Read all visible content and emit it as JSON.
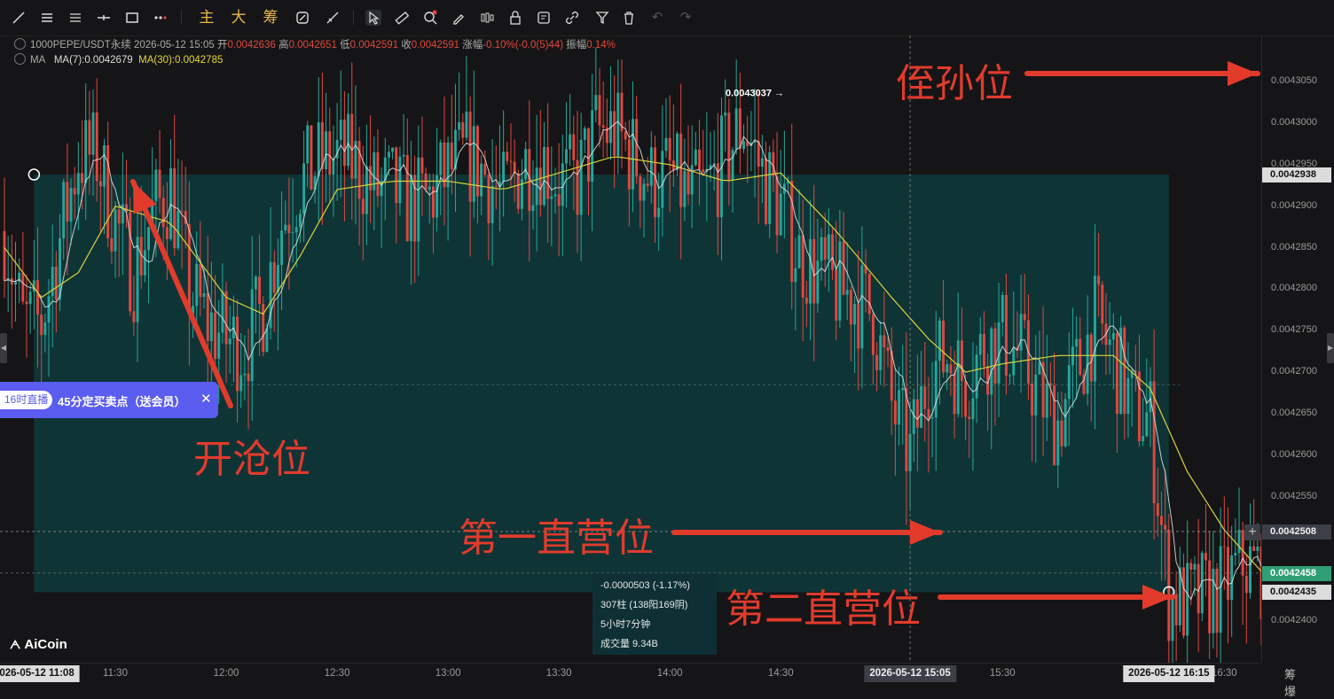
{
  "toolbar": {
    "btn_main": "主",
    "btn_big": "大",
    "btn_chips": "筹"
  },
  "info": {
    "symbol": "1000PEPE/USDT永续",
    "datetime": "2026-05-12 15:05",
    "open_label": "开",
    "open": "0.0042636",
    "high_label": "高",
    "high": "0.0042651",
    "low_label": "低",
    "low": "0.0042591",
    "close_label": "收",
    "close": "0.0042591",
    "change_label": "涨幅",
    "change": "-0.10%(-0.0(5)44)",
    "amp_label": "振幅",
    "amp": "0.14%",
    "ma_label": "MA",
    "ma7": "MA(7):0.0042679",
    "ma30": "MA(30):0.0042785"
  },
  "chart_data": {
    "type": "candlestick",
    "title": "",
    "interval": "1m",
    "x_start": "11:00",
    "x_end": "16:40",
    "ylim": [
      0.004235,
      0.004308
    ],
    "y_ticks": [
      "0.0043050",
      "0.0043000",
      "0.0042950",
      "0.0042900",
      "0.0042850",
      "0.0042800",
      "0.0042750",
      "0.0042700",
      "0.0042650",
      "0.0042600",
      "0.0042550",
      "0.0042500",
      "0.0042450",
      "0.0042400"
    ],
    "x_ticks": [
      "11:30",
      "12:00",
      "12:30",
      "13:00",
      "13:30",
      "14:00",
      "14:30",
      "15:30",
      "16:30"
    ],
    "max_label": "0.0043037",
    "price_path": [
      [
        "11:00",
        0.004287
      ],
      [
        "11:05",
        0.004276
      ],
      [
        "11:10",
        0.004276
      ],
      [
        "11:15",
        0.004286
      ],
      [
        "11:20",
        0.004296
      ],
      [
        "11:25",
        0.004296
      ],
      [
        "11:30",
        0.004288
      ],
      [
        "11:35",
        0.004282
      ],
      [
        "11:40",
        0.004289
      ],
      [
        "11:45",
        0.004292
      ],
      [
        "11:50",
        0.00428
      ],
      [
        "11:55",
        0.004276
      ],
      [
        "12:00",
        0.004274
      ],
      [
        "12:05",
        0.004273
      ],
      [
        "12:10",
        0.004278
      ],
      [
        "12:15",
        0.004288
      ],
      [
        "12:20",
        0.004293
      ],
      [
        "12:25",
        0.004295
      ],
      [
        "12:30",
        0.004296
      ],
      [
        "12:35",
        0.004295
      ],
      [
        "12:40",
        0.004292
      ],
      [
        "12:45",
        0.004292
      ],
      [
        "12:50",
        0.00429
      ],
      [
        "12:55",
        0.004291
      ],
      [
        "13:00",
        0.004294
      ],
      [
        "13:05",
        0.004296
      ],
      [
        "13:10",
        0.004294
      ],
      [
        "13:15",
        0.004291
      ],
      [
        "13:20",
        0.004295
      ],
      [
        "13:25",
        0.004296
      ],
      [
        "13:30",
        0.004293
      ],
      [
        "13:35",
        0.004293
      ],
      [
        "13:40",
        0.004299
      ],
      [
        "13:45",
        0.004299
      ],
      [
        "13:50",
        0.004296
      ],
      [
        "13:55",
        0.004293
      ],
      [
        "14:00",
        0.004294
      ],
      [
        "14:05",
        0.004291
      ],
      [
        "14:10",
        0.004292
      ],
      [
        "14:15",
        0.004296
      ],
      [
        "14:20",
        0.0043
      ],
      [
        "14:25",
        0.004294
      ],
      [
        "14:30",
        0.00429
      ],
      [
        "14:35",
        0.004284
      ],
      [
        "14:40",
        0.004282
      ],
      [
        "14:45",
        0.00428
      ],
      [
        "14:50",
        0.004279
      ],
      [
        "14:55",
        0.004277
      ],
      [
        "15:00",
        0.004266
      ],
      [
        "15:05",
        0.00426
      ],
      [
        "15:10",
        0.00427
      ],
      [
        "15:15",
        0.004272
      ],
      [
        "15:20",
        0.004269
      ],
      [
        "15:25",
        0.004273
      ],
      [
        "15:30",
        0.004274
      ],
      [
        "15:35",
        0.004272
      ],
      [
        "15:40",
        0.004267
      ],
      [
        "15:45",
        0.004264
      ],
      [
        "15:50",
        0.00427
      ],
      [
        "15:55",
        0.004276
      ],
      [
        "16:00",
        0.004272
      ],
      [
        "16:05",
        0.004266
      ],
      [
        "16:10",
        0.004264
      ],
      [
        "16:15",
        0.004243
      ],
      [
        "16:20",
        0.004242
      ],
      [
        "16:25",
        0.004243
      ],
      [
        "16:30",
        0.004244
      ],
      [
        "16:35",
        0.004247
      ],
      [
        "16:40",
        0.004246
      ]
    ],
    "ma30_path": [
      [
        "11:00",
        0.004285
      ],
      [
        "11:10",
        0.004279
      ],
      [
        "11:20",
        0.004282
      ],
      [
        "11:30",
        0.00429
      ],
      [
        "11:45",
        0.004288
      ],
      [
        "12:00",
        0.004279
      ],
      [
        "12:10",
        0.004277
      ],
      [
        "12:20",
        0.004284
      ],
      [
        "12:30",
        0.004292
      ],
      [
        "12:45",
        0.004293
      ],
      [
        "13:00",
        0.004293
      ],
      [
        "13:15",
        0.004292
      ],
      [
        "13:30",
        0.004294
      ],
      [
        "13:45",
        0.004296
      ],
      [
        "14:00",
        0.004295
      ],
      [
        "14:15",
        0.004293
      ],
      [
        "14:30",
        0.004294
      ],
      [
        "14:45",
        0.004287
      ],
      [
        "15:00",
        0.004279
      ],
      [
        "15:10",
        0.004274
      ],
      [
        "15:20",
        0.00427
      ],
      [
        "15:30",
        0.004271
      ],
      [
        "15:45",
        0.004272
      ],
      [
        "16:00",
        0.004272
      ],
      [
        "16:10",
        0.004268
      ],
      [
        "16:20",
        0.004258
      ],
      [
        "16:30",
        0.004251
      ],
      [
        "16:40",
        0.004246
      ]
    ],
    "position_box": {
      "from": "11:08",
      "to": "16:15",
      "top": 0.0042938,
      "bottom": 0.0042435
    },
    "crosshair": {
      "time": "2026-05-12 15:05",
      "price": "0.0042508"
    },
    "price_tags": {
      "entry": "0.0042938",
      "crosshair": "0.0042508",
      "last": "0.0042458",
      "box_bottom": "0.0042435"
    },
    "range_stats": {
      "change": "-0.0000503 (-1.17%)",
      "bars": "307柱 (138阳169阴)",
      "duration": "5小时7分钟",
      "volume": "成交量 9.34B"
    },
    "x_tags": {
      "left": "2026-05-12 11:08",
      "mid": "2026-05-12 15:05",
      "right": "2026-05-12 16:15"
    },
    "colors": {
      "up": "#26a69a",
      "down": "#e0483f",
      "ma7": "#e6e6e6",
      "ma30": "#d9d23a",
      "box": "#0e3a3c",
      "annotation": "#e23b2c"
    }
  },
  "annotations": {
    "stop": "侄孙位",
    "entry": "开沧位",
    "tp1": "第一直营位",
    "tp2": "第二直营位"
  },
  "promo": {
    "tag": "16时直播",
    "text": "45分定买卖点（送会员）",
    "close": "✕"
  },
  "logo": "AiCoin",
  "corner": "筹 爆"
}
